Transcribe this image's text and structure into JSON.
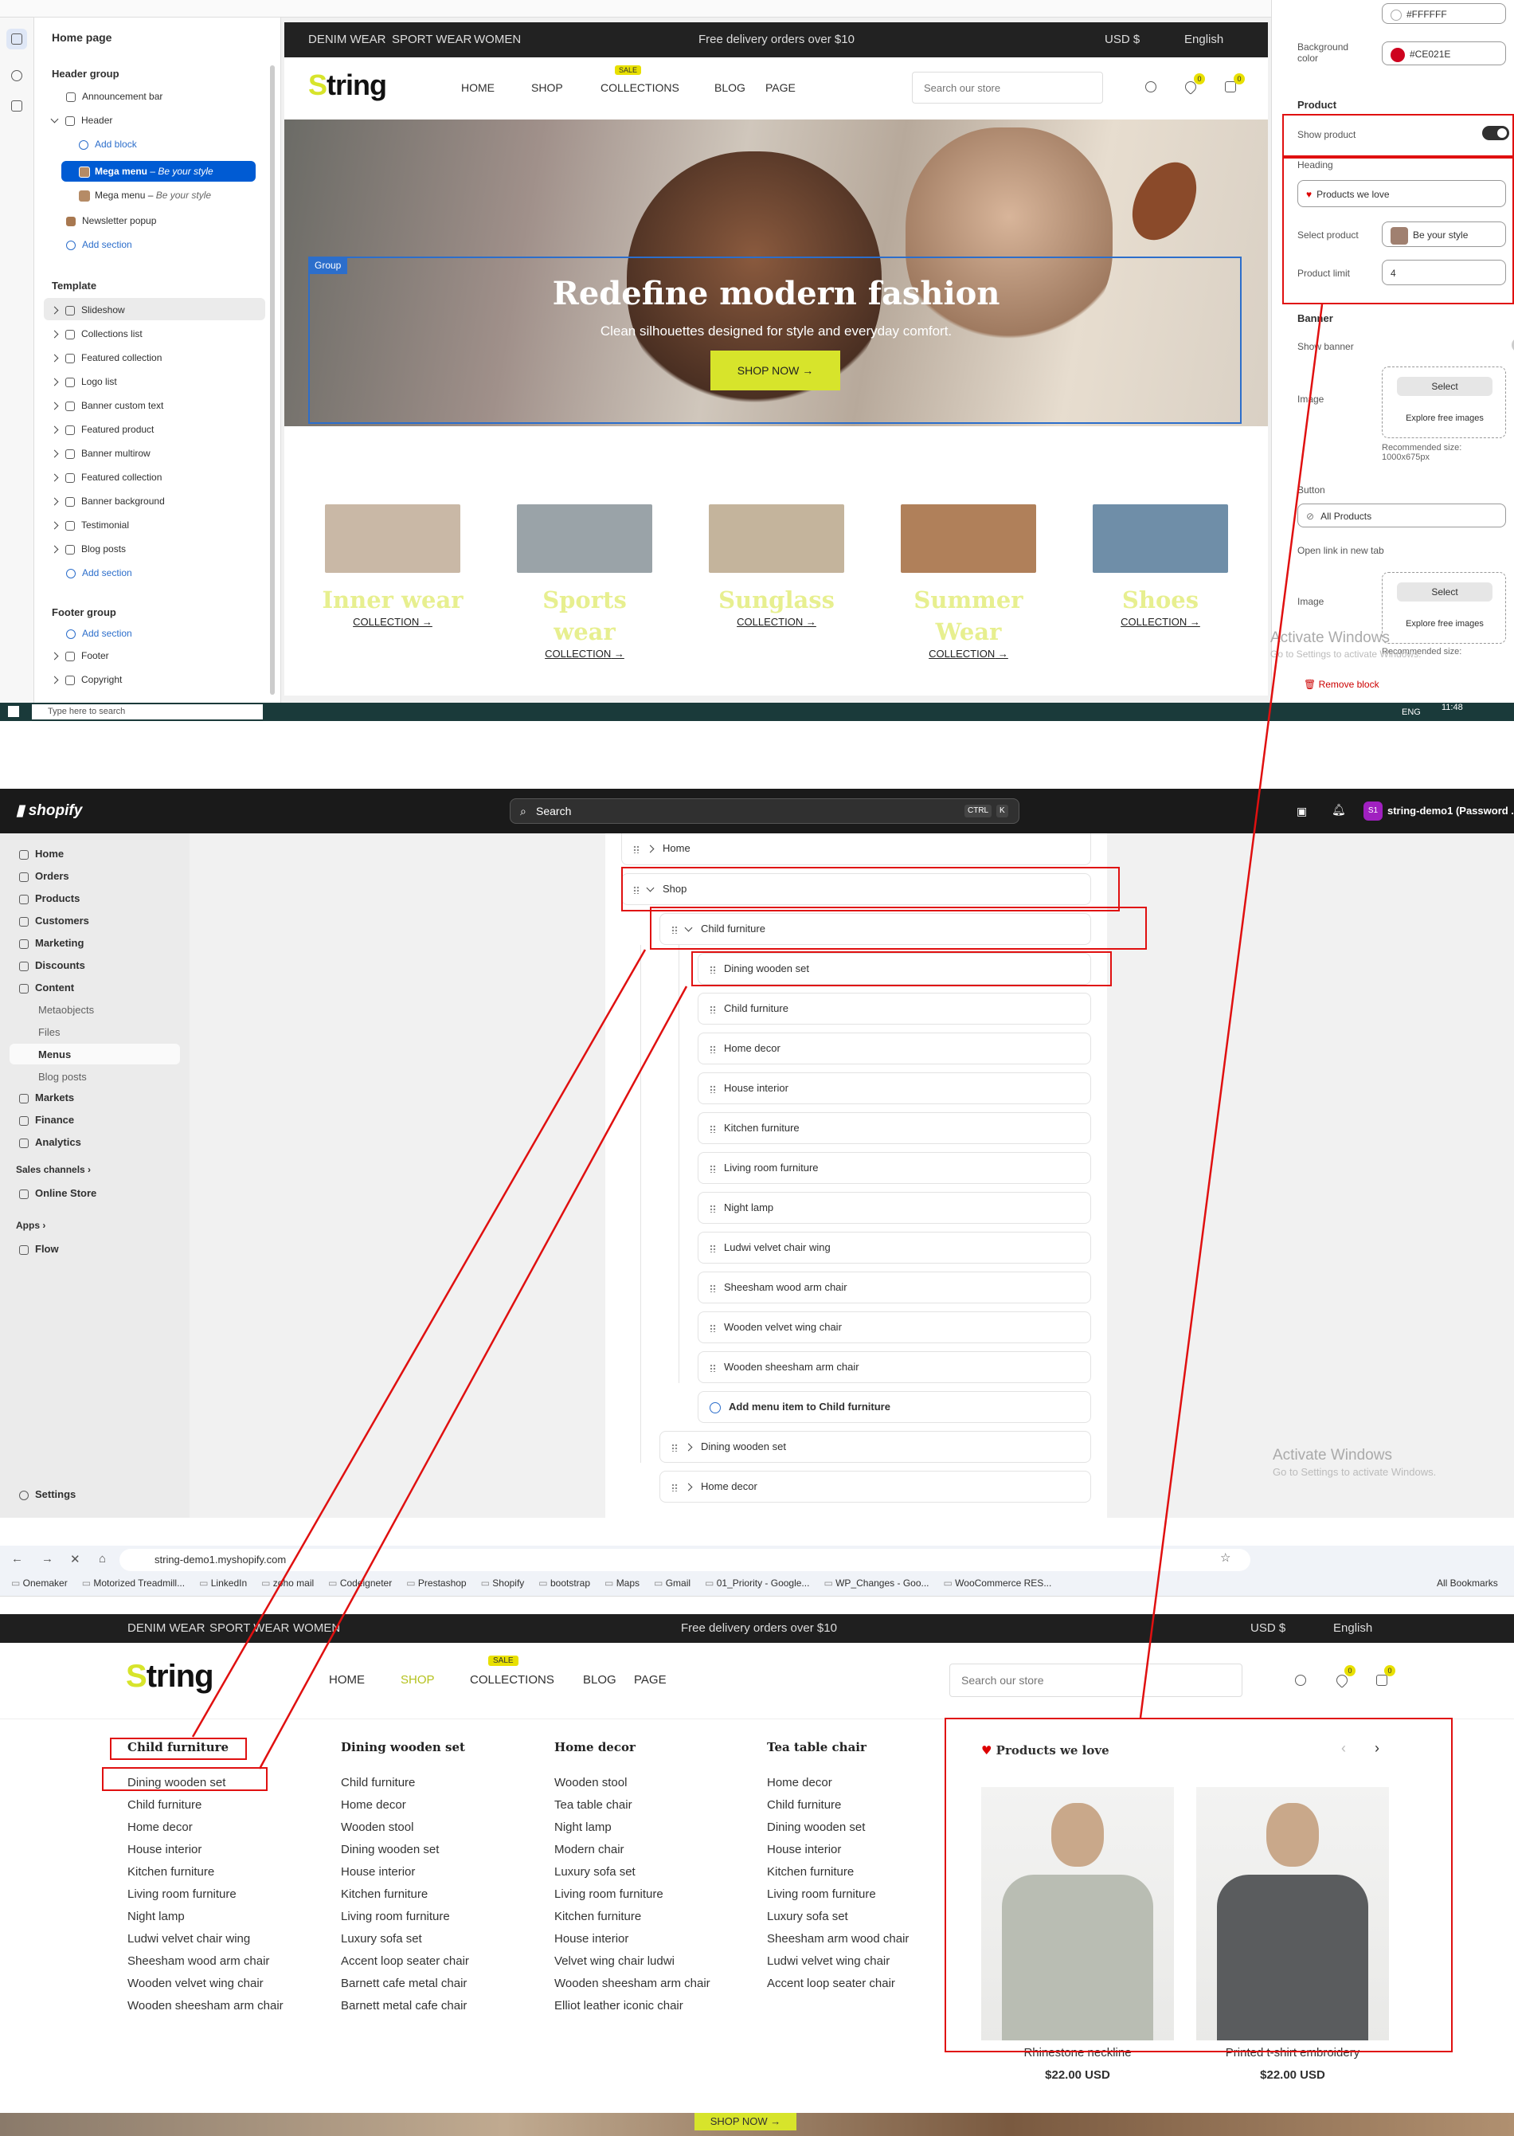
{
  "editor": {
    "page_title": "Home page",
    "header_group": "Header group",
    "header_items": [
      "Announcement bar",
      "Header"
    ],
    "add_block": "Add block",
    "mega_menu_selected": "Mega menu",
    "mega_menu_selected_sub": "Be your style",
    "mega_menu_2": "Mega menu",
    "mega_menu_2_sub": "Be your style",
    "newsletter": "Newsletter popup",
    "add_section": "Add section",
    "template": "Template",
    "template_items": [
      "Slideshow",
      "Collections list",
      "Featured collection",
      "Logo list",
      "Banner custom text",
      "Featured product",
      "Banner multirow",
      "Featured collection",
      "Banner background",
      "Testimonial",
      "Blog posts"
    ],
    "footer_group": "Footer group",
    "footer_items": [
      "Footer",
      "Copyright"
    ]
  },
  "preview": {
    "topbar_links": [
      "DENIM WEAR",
      "SPORT WEAR",
      "WOMEN"
    ],
    "topbar_promo": "Free delivery orders over $10",
    "currency": "USD $",
    "language": "English",
    "logo_s": "S",
    "logo_rest": "tring",
    "nav": [
      "HOME",
      "SHOP",
      "COLLECTIONS",
      "BLOG",
      "PAGE"
    ],
    "sale_badge": "SALE",
    "search_placeholder": "Search our store",
    "wishlist_count": "0",
    "cart_count": "0",
    "group_tag": "Group",
    "hero_title": "Redefine modern fashion",
    "hero_subtitle": "Clean silhouettes designed for style and everyday comfort.",
    "hero_button": "SHOP NOW",
    "categories": [
      {
        "name": "Inner wear",
        "link": "COLLECTION"
      },
      {
        "name": "Sports wear",
        "link": "COLLECTION"
      },
      {
        "name": "Sunglass",
        "link": "COLLECTION"
      },
      {
        "name": "Summer Wear",
        "link": "COLLECTION"
      },
      {
        "name": "Shoes",
        "link": "COLLECTION"
      }
    ]
  },
  "settings": {
    "color_value": "#FFFFFF",
    "bg_color_label": "Background color",
    "bg_color_value": "#CE021E",
    "product_section": "Product",
    "show_product": "Show product",
    "show_product_on": true,
    "heading_label": "Heading",
    "heading_value": "Products we love",
    "select_product_label": "Select product",
    "select_product_value": "Be your style",
    "product_limit_label": "Product limit",
    "product_limit_value": "4",
    "banner_section": "Banner",
    "show_banner": "Show banner",
    "image_label": "Image",
    "select_btn": "Select",
    "explore": "Explore free images",
    "recommended": "Recommended size: 1000x675px",
    "button_label": "Button",
    "button_value": "All Products",
    "open_new_tab": "Open link in new tab",
    "image2_label": "Image",
    "recommended2": "Recommended size:",
    "remove_block": "Remove block",
    "activate": "Activate Windows",
    "activate_sub": "Go to Settings to activate Windows."
  },
  "taskbar": {
    "search": "Type here to search",
    "lang": "ENG",
    "time": "11:48"
  },
  "admin": {
    "brand": "shopify",
    "search": "Search",
    "shortcut1": "CTRL",
    "shortcut2": "K",
    "store_initials": "S1",
    "store": "string-demo1 (Password ...",
    "nav": [
      "Home",
      "Orders",
      "Products",
      "Customers",
      "Marketing",
      "Discounts",
      "Content"
    ],
    "content_sub": [
      "Metaobjects",
      "Files",
      "Menus",
      "Blog posts"
    ],
    "nav2": [
      "Markets",
      "Finance",
      "Analytics"
    ],
    "sales_channels": "Sales channels",
    "online_store": "Online Store",
    "apps": "Apps",
    "flow": "Flow",
    "settings": "Settings",
    "menu_top": [
      "Home",
      "Shop",
      "Child furniture"
    ],
    "menu_children": [
      "Dining wooden set",
      "Child furniture",
      "Home decor",
      "House interior",
      "Kitchen furniture",
      "Living room furniture",
      "Night lamp",
      "Ludwi velvet chair wing",
      "Sheesham wood arm chair",
      "Wooden velvet wing chair",
      "Wooden sheesham arm chair"
    ],
    "add_item": "Add menu item to Child furniture",
    "menu_after": [
      "Dining wooden set",
      "Home decor"
    ],
    "activate": "Activate Windows",
    "activate_sub": "Go to Settings to activate Windows."
  },
  "browser": {
    "url": "string-demo1.myshopify.com",
    "bookmarks": [
      "Onemaker",
      "Motorized Treadmill...",
      "LinkedIn",
      "zoho mail",
      "Codeigneter",
      "Prestashop",
      "Shopify",
      "bootstrap",
      "Maps",
      "Gmail",
      "01_Priority - Google...",
      "WP_Changes - Goo...",
      "WooCommerce RES..."
    ],
    "all_bookmarks": "All Bookmarks"
  },
  "store": {
    "topbar_links": [
      "DENIM WEAR",
      "SPORT WEAR",
      "WOMEN"
    ],
    "promo": "Free delivery orders over $10",
    "currency": "USD $",
    "language": "English",
    "logo_s": "S",
    "logo_rest": "tring",
    "nav": [
      "HOME",
      "SHOP",
      "COLLECTIONS",
      "BLOG",
      "PAGE"
    ],
    "sale": "SALE",
    "search_placeholder": "Search our store",
    "wish_count": "0",
    "cart_count": "0",
    "columns": [
      {
        "heading": "Child furniture",
        "items": [
          "Dining wooden set",
          "Child furniture",
          "Home decor",
          "House interior",
          "Kitchen furniture",
          "Living room furniture",
          "Night lamp",
          "Ludwi velvet chair wing",
          "Sheesham wood arm chair",
          "Wooden velvet wing chair",
          "Wooden sheesham arm chair"
        ]
      },
      {
        "heading": "Dining wooden set",
        "items": [
          "Child furniture",
          "Home decor",
          "Wooden stool",
          "Dining wooden set",
          "House interior",
          "Kitchen furniture",
          "Living room furniture",
          "Luxury sofa set",
          "Accent loop seater chair",
          "Barnett cafe metal chair",
          "Barnett metal cafe chair"
        ]
      },
      {
        "heading": "Home decor",
        "items": [
          "Wooden stool",
          "Tea table chair",
          "Night lamp",
          "Modern chair",
          "Luxury sofa set",
          "Living room furniture",
          "Kitchen furniture",
          "House interior",
          "Velvet wing chair ludwi",
          "Wooden sheesham arm chair",
          "Elliot leather iconic chair"
        ]
      },
      {
        "heading": "Tea table chair",
        "items": [
          "Home decor",
          "Child furniture",
          "Dining wooden set",
          "House interior",
          "Kitchen furniture",
          "Living room furniture",
          "Luxury sofa set",
          "Sheesham arm wood chair",
          "Ludwi velvet wing chair",
          "Accent loop seater chair"
        ]
      }
    ],
    "products_heading": "Products we love",
    "products": [
      {
        "name": "Rhinestone neckline",
        "price": "$22.00 USD"
      },
      {
        "name": "Printed t-shirt embroidery",
        "price": "$22.00 USD"
      }
    ],
    "shop_now": "SHOP NOW"
  },
  "colors": {
    "accent_lime": "#D7E42B",
    "annotation_red": "#E01010",
    "shopify_blue": "#005BD3",
    "bg_swatch": "#CE021E"
  }
}
